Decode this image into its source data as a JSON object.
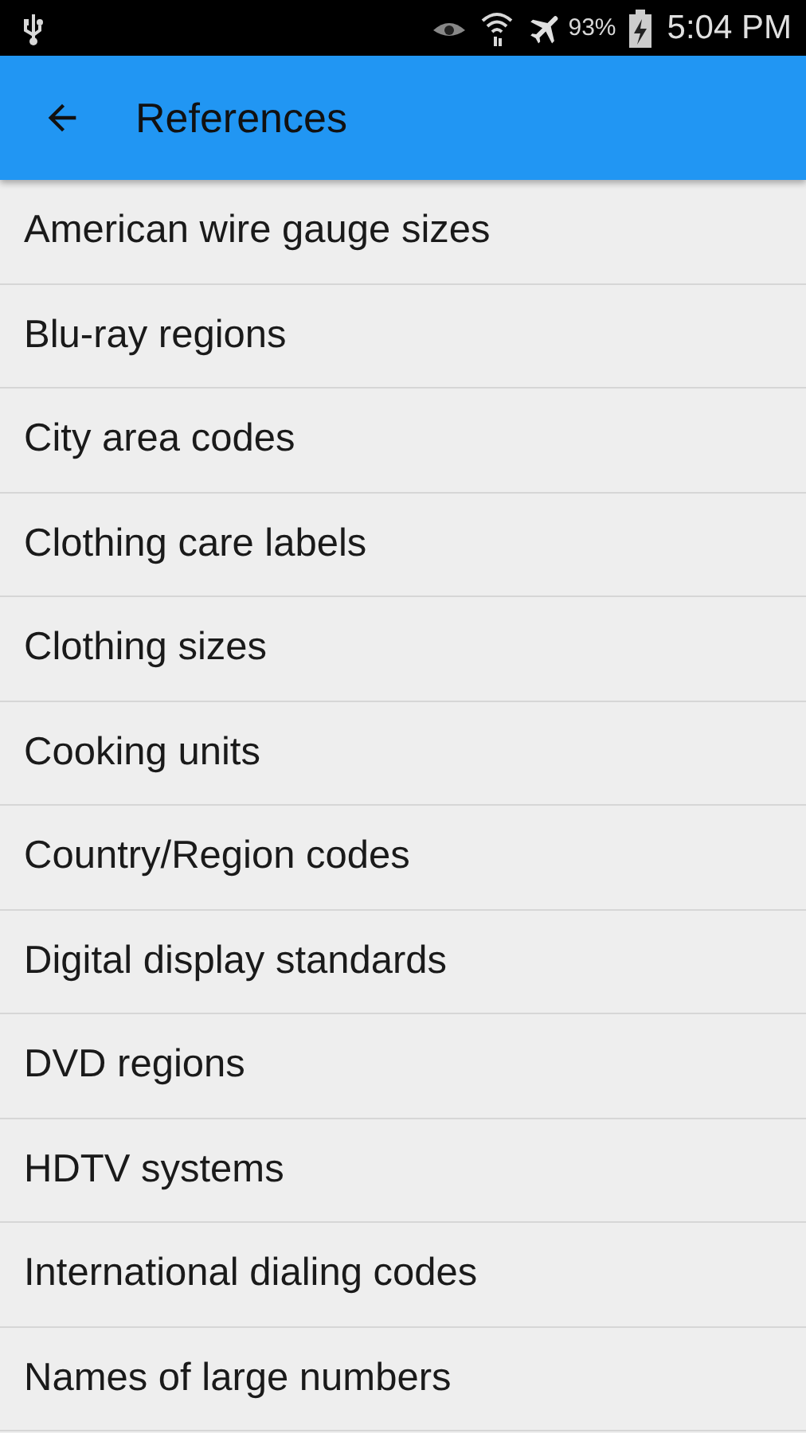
{
  "status_bar": {
    "battery_percent": "93%",
    "time": "5:04 PM"
  },
  "app_bar": {
    "title": "References"
  },
  "items": [
    {
      "label": "American wire gauge sizes"
    },
    {
      "label": "Blu-ray regions"
    },
    {
      "label": "City area codes"
    },
    {
      "label": "Clothing care labels"
    },
    {
      "label": "Clothing sizes"
    },
    {
      "label": "Cooking units"
    },
    {
      "label": "Country/Region codes"
    },
    {
      "label": "Digital display standards"
    },
    {
      "label": "DVD regions"
    },
    {
      "label": "HDTV systems"
    },
    {
      "label": "International dialing codes"
    },
    {
      "label": "Names of large numbers"
    }
  ]
}
